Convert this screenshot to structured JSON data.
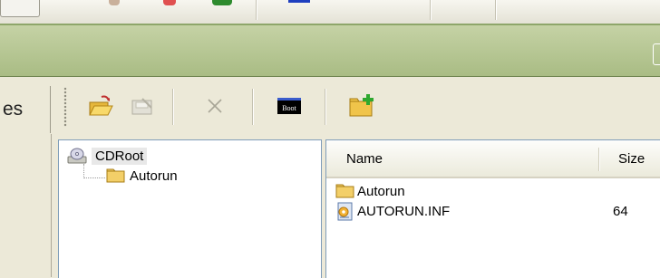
{
  "left_tab": {
    "label": "es"
  },
  "toolbar": {
    "buttons": [
      {
        "name": "open-folder",
        "icon": "open-folder-icon",
        "enabled": true
      },
      {
        "name": "save",
        "icon": "save-icon",
        "enabled": false
      },
      {
        "name": "delete",
        "icon": "close-icon",
        "enabled": false
      },
      {
        "name": "boot",
        "icon": "boot-icon",
        "label": "Boot",
        "enabled": true
      },
      {
        "name": "new-folder",
        "icon": "new-folder-icon",
        "enabled": true
      }
    ]
  },
  "tree": {
    "root": {
      "label": "CDRoot",
      "icon": "cd-drive-icon"
    },
    "children": [
      {
        "label": "Autorun",
        "icon": "folder-icon"
      }
    ]
  },
  "list": {
    "columns": [
      "Name",
      "Size"
    ],
    "rows": [
      {
        "name": "Autorun",
        "size": "",
        "icon": "folder-icon"
      },
      {
        "name": "AUTORUN.INF",
        "size": "64",
        "icon": "inf-file-icon"
      }
    ]
  },
  "colors": {
    "green_band": "#b4c690",
    "selection": "#e8e8e8",
    "pane_border": "#7f9db9"
  }
}
